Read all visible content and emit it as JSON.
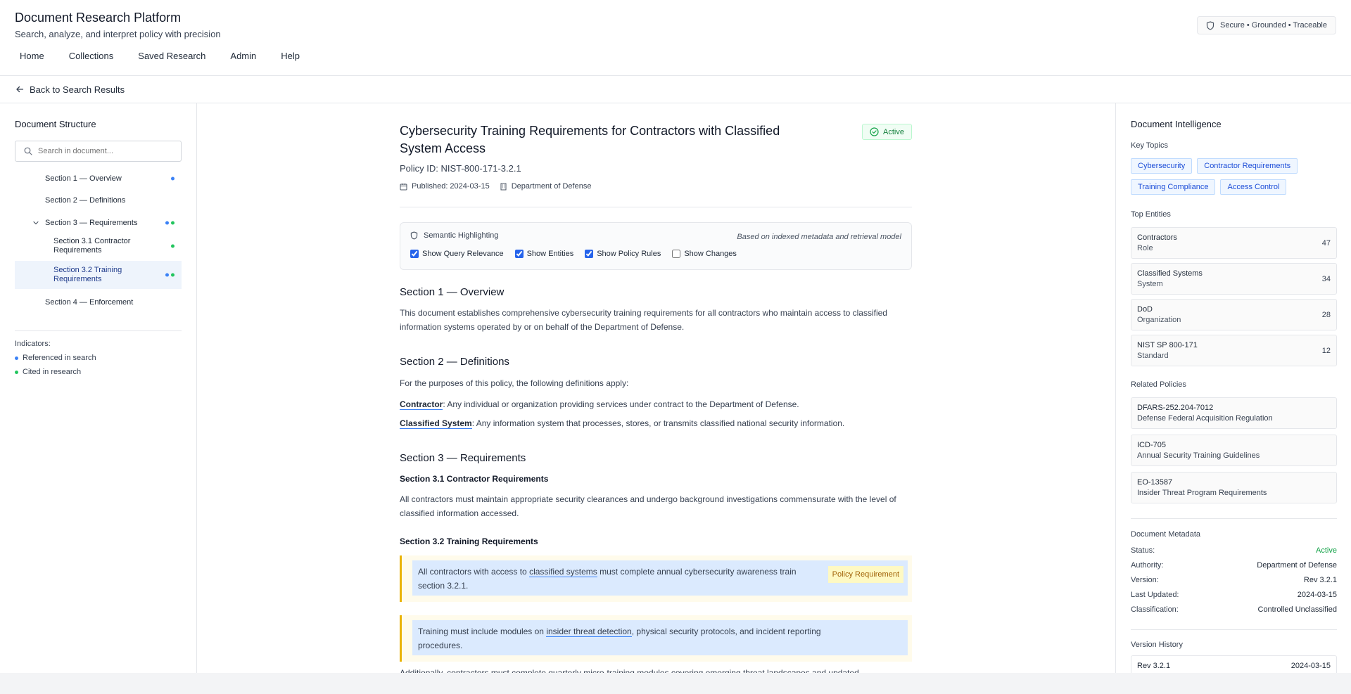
{
  "header": {
    "title": "Document Research Platform",
    "subtitle": "Search, analyze, and interpret policy with precision",
    "badge": "Secure • Grounded • Traceable",
    "nav": [
      "Home",
      "Collections",
      "Saved Research",
      "Admin",
      "Help"
    ]
  },
  "backbar": {
    "label": "Back to Search Results"
  },
  "left": {
    "title": "Document Structure",
    "search_placeholder": "Search in document...",
    "toc": [
      {
        "label": "Section 1 — Overview"
      },
      {
        "label": "Section 2 — Definitions"
      },
      {
        "label": "Section 3 — Requirements"
      },
      {
        "label": "Section 3.1 Contractor Requirements"
      },
      {
        "label": "Section 3.2 Training Requirements"
      },
      {
        "label": "Section 4 — Enforcement"
      }
    ],
    "indicators_title": "Indicators:",
    "indicators": [
      "Referenced in search",
      "Cited in research"
    ]
  },
  "doc": {
    "title": "Cybersecurity Training Requirements for Contractors with Classified System Access",
    "status": "Active",
    "policy_id": "Policy ID: NIST-800-171-3.2.1",
    "published": "Published: 2024-03-15",
    "department": "Department of Defense",
    "semantic": {
      "title": "Semantic Highlighting",
      "note": "Based on indexed metadata and retrieval model",
      "options": [
        "Show Query Relevance",
        "Show Entities",
        "Show Policy Rules",
        "Show Changes"
      ]
    },
    "s1_title": "Section 1 — Overview",
    "s1_text": "This document establishes comprehensive cybersecurity training requirements for all contractors who maintain access to classified information systems operated by or on behalf of the Department of Defense.",
    "s2_title": "Section 2 — Definitions",
    "s2_intro": "For the purposes of this policy, the following definitions apply:",
    "def1_term": "Contractor",
    "def1_text": ": Any individual or organization providing services under contract to the Department of Defense.",
    "def2_term": "Classified System",
    "def2_text": ": Any information system that processes, stores, or transmits classified national security information.",
    "s3_title": "Section 3 — Requirements",
    "s31_title": "Section 3.1 Contractor Requirements",
    "s31_text": "All contractors must maintain appropriate security clearances and undergo background investigations commensurate with the level of classified information accessed.",
    "s32_title": "Section 3.2 Training Requirements",
    "req1_pre": "All contractors with access to ",
    "req1_link": "classified systems",
    "req1_post": " must complete annual cybersecurity awareness train",
    "req1_line2": "section 3.2.1.",
    "req1_tag": "Policy Requirement",
    "req2_pre": "Training must include modules on ",
    "req2_link": "insider threat detection",
    "req2_post": ", physical security protocols, and incident reporting",
    "req2_line2": "procedures.",
    "trailing": "Additionally, contractors must complete quarterly micro-training modules covering emerging threat landscapes and updated"
  },
  "right": {
    "title": "Document Intelligence",
    "topics_title": "Key Topics",
    "topics": [
      "Cybersecurity",
      "Contractor Requirements",
      "Training Compliance",
      "Access Control"
    ],
    "entities_title": "Top Entities",
    "entities": [
      {
        "name": "Contractors",
        "type": "Role",
        "count": "47"
      },
      {
        "name": "Classified Systems",
        "type": "System",
        "count": "34"
      },
      {
        "name": "DoD",
        "type": "Organization",
        "count": "28"
      },
      {
        "name": "NIST SP 800-171",
        "type": "Standard",
        "count": "12"
      }
    ],
    "policies_title": "Related Policies",
    "policies": [
      {
        "id": "DFARS-252.204-7012",
        "name": "Defense Federal Acquisition Regulation"
      },
      {
        "id": "ICD-705",
        "name": "Annual Security Training Guidelines"
      },
      {
        "id": "EO-13587",
        "name": "Insider Threat Program Requirements"
      }
    ],
    "metadata_title": "Document Metadata",
    "metadata": [
      {
        "k": "Status:",
        "v": "Active"
      },
      {
        "k": "Authority:",
        "v": "Department of Defense"
      },
      {
        "k": "Version:",
        "v": "Rev 3.2.1"
      },
      {
        "k": "Last Updated:",
        "v": "2024-03-15"
      },
      {
        "k": "Classification:",
        "v": "Controlled Unclassified"
      }
    ],
    "history_title": "Version History",
    "history": [
      {
        "rev": "Rev 3.2.1",
        "date": "2024-03-15"
      }
    ]
  }
}
